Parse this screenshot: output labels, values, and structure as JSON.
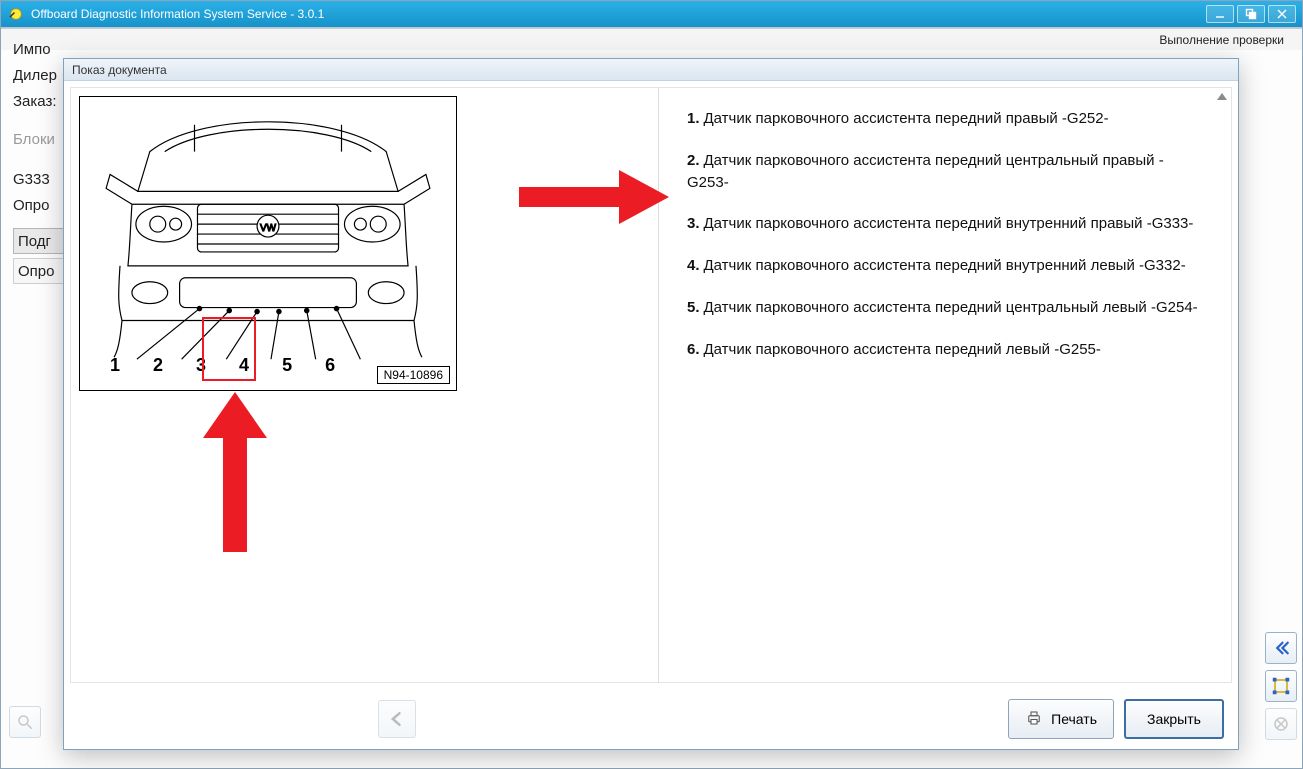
{
  "window": {
    "title": "Offboard Diagnostic Information System Service - 3.0.1"
  },
  "left_panel": {
    "rows": [
      "Импо",
      "Дилер",
      "Заказ:",
      "Блоки",
      "G333",
      "Опро",
      "Подг",
      "Опро"
    ]
  },
  "dialog": {
    "title": "Показ документа",
    "figure_part_no": "N94-10896",
    "callout_numbers": [
      "1",
      "2",
      "3",
      "4",
      "5",
      "6"
    ],
    "sensor_list": [
      {
        "n": "1.",
        "text": "Датчик парковочного ассистента передний правый -G252-"
      },
      {
        "n": "2.",
        "text": "Датчик парковочного ассистента передний центральный правый -G253-"
      },
      {
        "n": "3.",
        "text": "Датчик парковочного ассистента передний внутренний правый -G333-"
      },
      {
        "n": "4.",
        "text": "Датчик парковочного ассистента передний внутренний левый -G332-"
      },
      {
        "n": "5.",
        "text": "Датчик парковочного ассистента передний центральный левый -G254-"
      },
      {
        "n": "6.",
        "text": "Датчик парковочного ассистента передний левый -G255-"
      }
    ],
    "buttons": {
      "print": "Печать",
      "close": "Закрыть"
    }
  },
  "statusbar": {
    "text": "Выполнение проверки"
  }
}
